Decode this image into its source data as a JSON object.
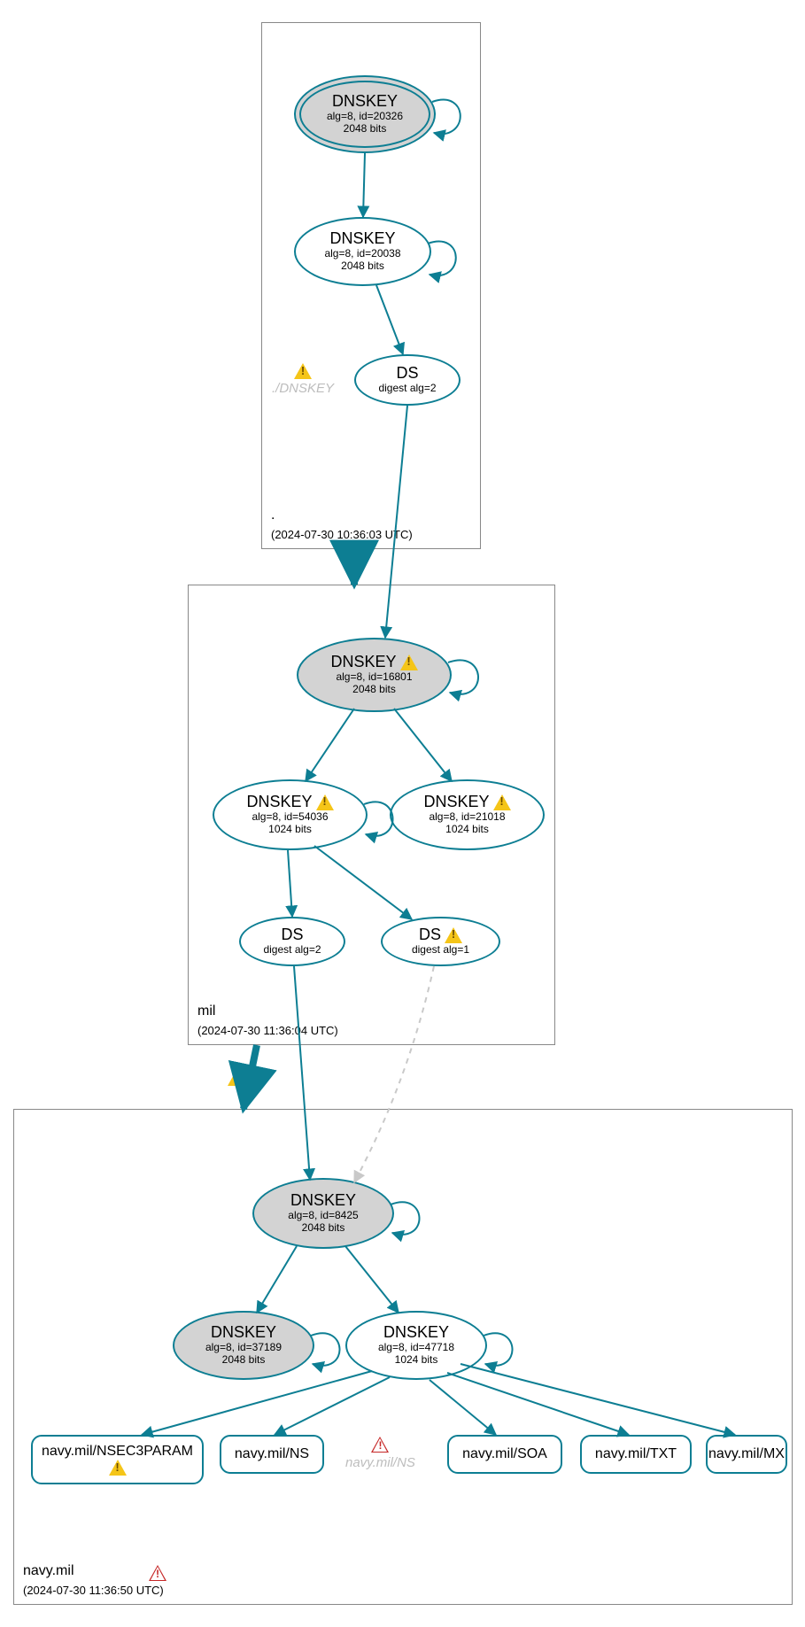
{
  "zones": {
    "root": {
      "label": ".",
      "timestamp": "(2024-07-30 10:36:03 UTC)"
    },
    "mil": {
      "label": "mil",
      "timestamp": "(2024-07-30 11:36:04 UTC)"
    },
    "navy": {
      "label": "navy.mil",
      "timestamp": "(2024-07-30 11:36:50 UTC)"
    }
  },
  "nodes": {
    "root_ksk": {
      "title": "DNSKEY",
      "line1": "alg=8, id=20326",
      "line2": "2048 bits"
    },
    "root_zsk": {
      "title": "DNSKEY",
      "line1": "alg=8, id=20038",
      "line2": "2048 bits"
    },
    "root_ds": {
      "title": "DS",
      "line1": "digest alg=2",
      "line2": ""
    },
    "mil_ksk": {
      "title": "DNSKEY",
      "line1": "alg=8, id=16801",
      "line2": "2048 bits"
    },
    "mil_zsk1": {
      "title": "DNSKEY",
      "line1": "alg=8, id=54036",
      "line2": "1024 bits"
    },
    "mil_zsk2": {
      "title": "DNSKEY",
      "line1": "alg=8, id=21018",
      "line2": "1024 bits"
    },
    "mil_ds1": {
      "title": "DS",
      "line1": "digest alg=2",
      "line2": ""
    },
    "mil_ds2": {
      "title": "DS",
      "line1": "digest alg=1",
      "line2": ""
    },
    "navy_ksk": {
      "title": "DNSKEY",
      "line1": "alg=8, id=8425",
      "line2": "2048 bits"
    },
    "navy_k2": {
      "title": "DNSKEY",
      "line1": "alg=8, id=37189",
      "line2": "2048 bits"
    },
    "navy_zsk": {
      "title": "DNSKEY",
      "line1": "alg=8, id=47718",
      "line2": "1024 bits"
    }
  },
  "ghosts": {
    "root_dnskey": "./DNSKEY",
    "navy_ns": "navy.mil/NS"
  },
  "rr": {
    "nsec3": "navy.mil/NSEC3PARAM",
    "ns": "navy.mil/NS",
    "soa": "navy.mil/SOA",
    "txt": "navy.mil/TXT",
    "mx": "navy.mil/MX"
  },
  "colors": {
    "stroke": "#0d7e93",
    "ghost": "#c9c9c9"
  }
}
